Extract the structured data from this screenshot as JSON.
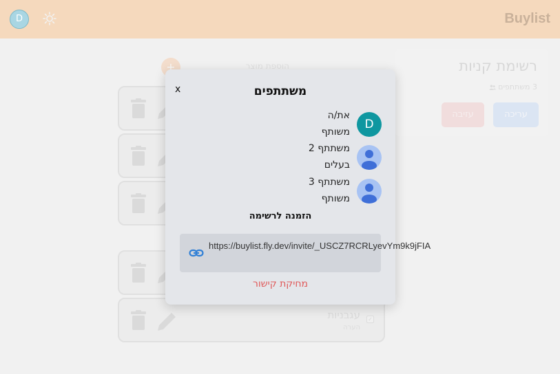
{
  "header": {
    "avatar_letter": "D",
    "brand": "Buylist"
  },
  "list_card": {
    "title": "רשימת קניות",
    "participants_count": "3 משתתפים",
    "edit_label": "עריכה",
    "leave_label": "עזיבה"
  },
  "add_product": {
    "icon": "+",
    "label": "הוספת מוצר"
  },
  "items": [
    {
      "name": "",
      "sub": ""
    },
    {
      "name": "",
      "sub": ""
    },
    {
      "name": "",
      "sub": ""
    },
    {
      "name": "",
      "sub": ""
    },
    {
      "name": "עגבניות",
      "sub": "הערה"
    }
  ],
  "modal": {
    "close": "x",
    "title": "משתתפים",
    "participants": [
      {
        "avatar": "D",
        "name": "את/ה",
        "role": "משותף"
      },
      {
        "avatar": "",
        "name": "משתתף 2",
        "role": "בעלים"
      },
      {
        "avatar": "",
        "name": "משתתף 3",
        "role": "משותף"
      }
    ],
    "invite_title": "הזמנה לרשימה",
    "invite_url": "https://buylist.fly.dev/invite/_USCZ7RCRLyevYm9k9jFIA",
    "delete_link": "מחיקת קישור"
  },
  "colors": {
    "header_bg": "#f5d9bd",
    "modal_bg": "#e4e6ea",
    "avatar_teal": "#0f97a0",
    "danger": "#e05a5a",
    "link_blue": "#2f7fd6"
  },
  "icons": [
    "sun-icon",
    "trash-icon",
    "pencil-icon",
    "link-icon",
    "person-icon",
    "users-icon"
  ]
}
